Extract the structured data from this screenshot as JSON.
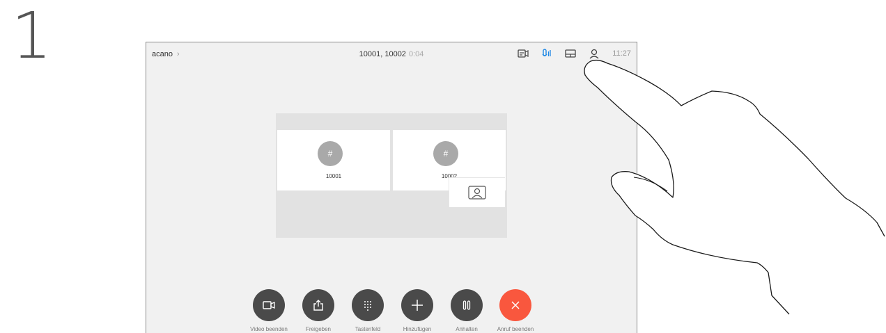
{
  "step_number": "1",
  "status_bar": {
    "breadcrumb": "acano",
    "breadcrumb_chevron": "›",
    "call_title": "10001, 10002",
    "call_duration": "0:04",
    "icons": [
      "self-view-icon",
      "microphone-icon",
      "layout-icon",
      "participants-icon"
    ],
    "time": "11:27",
    "accent_color": "#1e88e5"
  },
  "video_layout": {
    "participants": [
      {
        "avatar": "#",
        "name": "10001"
      },
      {
        "avatar": "#",
        "name": "10002"
      }
    ],
    "self_view_icon": "person-icon"
  },
  "controls": [
    {
      "icon": "video-camera-icon",
      "label": "Video beenden"
    },
    {
      "icon": "share-icon",
      "label": "Freigeben"
    },
    {
      "icon": "keypad-icon",
      "label": "Tastenfeld"
    },
    {
      "icon": "plus-icon",
      "label": "Hinzufügen"
    },
    {
      "icon": "pause-icon",
      "label": "Anhalten"
    },
    {
      "icon": "close-icon",
      "label": "Anruf beenden",
      "color": "#f9573e"
    }
  ]
}
